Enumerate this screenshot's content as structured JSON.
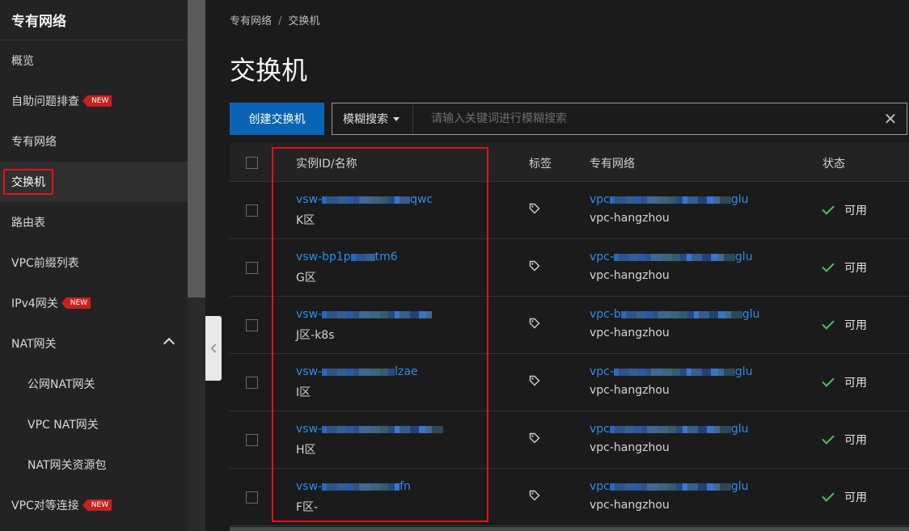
{
  "sidebar": {
    "title": "专有网络",
    "items": [
      {
        "label": "概览",
        "badge": "",
        "active": false,
        "sub": false
      },
      {
        "label": "自助问题排查",
        "badge": "NEW",
        "active": false,
        "sub": false
      },
      {
        "label": "专有网络",
        "badge": "",
        "active": false,
        "sub": false
      },
      {
        "label": "交换机",
        "badge": "",
        "active": true,
        "sub": false
      },
      {
        "label": "路由表",
        "badge": "",
        "active": false,
        "sub": false
      },
      {
        "label": "VPC前缀列表",
        "badge": "",
        "active": false,
        "sub": false
      },
      {
        "label": "IPv4网关",
        "badge": "NEW",
        "active": false,
        "sub": false
      },
      {
        "label": "NAT网关",
        "badge": "",
        "active": false,
        "sub": false,
        "expanded": true
      },
      {
        "label": "公网NAT网关",
        "badge": "",
        "active": false,
        "sub": true
      },
      {
        "label": "VPC NAT网关",
        "badge": "",
        "active": false,
        "sub": true
      },
      {
        "label": "NAT网关资源包",
        "badge": "",
        "active": false,
        "sub": true
      },
      {
        "label": "VPC对等连接",
        "badge": "NEW",
        "active": false,
        "sub": false
      }
    ]
  },
  "breadcrumb": {
    "parent": "专有网络",
    "separator": "/",
    "current": "交换机"
  },
  "page_title": "交换机",
  "toolbar": {
    "create_label": "创建交换机",
    "search_type": "模糊搜索",
    "search_placeholder": "请输入关键词进行模糊搜索"
  },
  "table": {
    "headers": {
      "id_name": "实例ID/名称",
      "tag": "标签",
      "vpc": "专有网络",
      "status": "状态"
    },
    "rows": [
      {
        "id_prefix": "vsw-",
        "id_suffix": "qwc",
        "name_prefix": "K区",
        "name_suffix": "",
        "vpc_prefix": "vpc",
        "vpc_suffix": "glu",
        "vpc_name": "vpc-hangzhou",
        "status": "可用"
      },
      {
        "id_prefix": "vsw-bp1p",
        "id_suffix": "tm6",
        "name_prefix": "G区",
        "name_suffix": "",
        "vpc_prefix": "vpc-",
        "vpc_suffix": "glu",
        "vpc_name": "vpc-hangzhou",
        "status": "可用"
      },
      {
        "id_prefix": "vsw-",
        "id_suffix": "",
        "name_prefix": "J区-",
        "name_suffix": "k8s",
        "vpc_prefix": "vpc-b",
        "vpc_suffix": "glu",
        "vpc_name": "vpc-hangzhou",
        "status": "可用"
      },
      {
        "id_prefix": "vsw-",
        "id_suffix": "lzae",
        "name_prefix": "I区",
        "name_suffix": "",
        "vpc_prefix": "vpc-",
        "vpc_suffix": "glu",
        "vpc_name": "vpc-hangzhou",
        "status": "可用"
      },
      {
        "id_prefix": "vsw-",
        "id_suffix": "",
        "name_prefix": "H区",
        "name_suffix": "",
        "vpc_prefix": "vpc",
        "vpc_suffix": "glu",
        "vpc_name": "vpc-hangzhou",
        "status": "可用"
      },
      {
        "id_prefix": "vsw-",
        "id_suffix": "fn",
        "name_prefix": "F区-",
        "name_suffix": "",
        "vpc_prefix": "vpc",
        "vpc_suffix": "glu",
        "vpc_name": "vpc-hangzhou",
        "status": "可用"
      }
    ]
  },
  "colors": {
    "accent": "#0a64b5",
    "link": "#2b8ff0",
    "badge": "#c6211c",
    "highlight": "#e0141a",
    "status_ok": "#46c365"
  }
}
